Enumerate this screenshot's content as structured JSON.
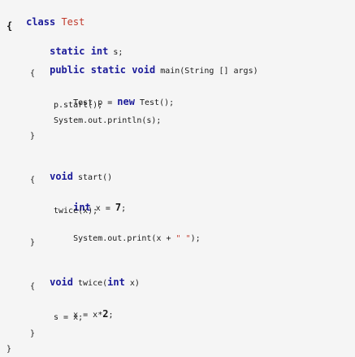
{
  "code": {
    "l1": {
      "kw": "class",
      "name": "Test"
    },
    "l2": {
      "brace": "{"
    },
    "l3": {
      "kw1": "static",
      "kw2": "int",
      "rest": " s;"
    },
    "l4": {
      "kw1": "public",
      "kw2": "static",
      "kw3": "void",
      "rest": " main(String [] args)"
    },
    "l5": {
      "brace": "{"
    },
    "l6": {
      "pre": "Test p = ",
      "kw": "new",
      "post": " Test();"
    },
    "l7": {
      "text": "p.start();"
    },
    "l8": {
      "text": "System.out.println(s);"
    },
    "l9": {
      "brace": "}"
    },
    "l10": {
      "kw": "void",
      "rest": " start()"
    },
    "l11": {
      "brace": "{"
    },
    "l12": {
      "kw": "int",
      "rest": " x = ",
      "num": "7",
      "end": ";"
    },
    "l13": {
      "text": "twice(x);"
    },
    "l14": {
      "pre": "System.out.print(x + ",
      "str": "\" \"",
      "post": ");"
    },
    "l15": {
      "brace": "}"
    },
    "l16": {
      "kw": "void",
      "mid": " twice(",
      "kw2": "int",
      "rest": " x)"
    },
    "l17": {
      "brace": "{"
    },
    "l18": {
      "pre": "x = x*",
      "num": "2",
      "end": ";"
    },
    "l19": {
      "text": "s = x;"
    },
    "l20": {
      "brace": "}"
    },
    "l21": {
      "brace": "}"
    }
  }
}
